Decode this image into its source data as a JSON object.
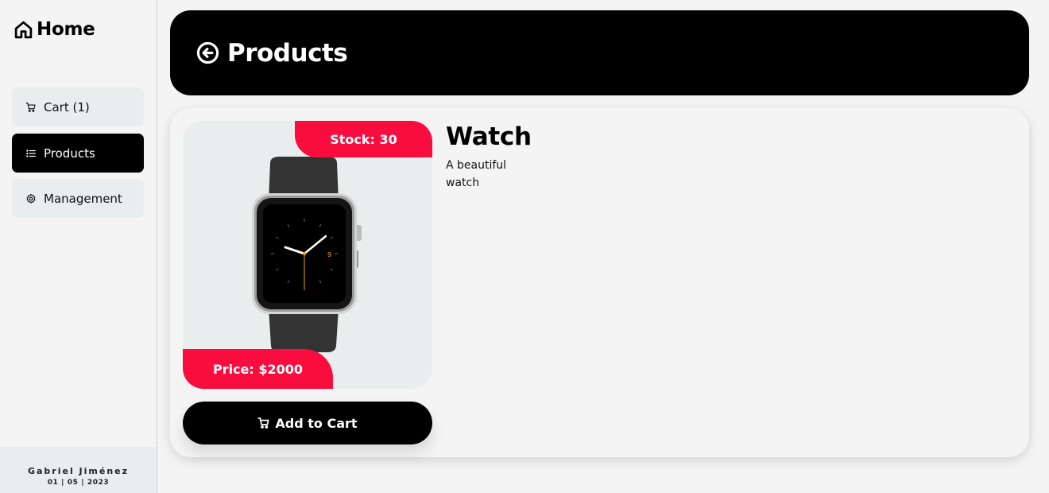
{
  "sidebar": {
    "brand": "Home",
    "items": [
      {
        "label": "Cart (1)",
        "icon": "cart-icon"
      },
      {
        "label": "Products",
        "icon": "list-icon",
        "active": true
      },
      {
        "label": "Management",
        "icon": "gear-icon"
      }
    ],
    "footer": {
      "name": "Gabriel Jiménez",
      "date": "01 | 05 | 2023"
    }
  },
  "header": {
    "title": "Products",
    "back_icon": "back-arrow-circle-icon"
  },
  "product": {
    "name": "Watch",
    "description": "A beautiful watch",
    "stock_label": "Stock: 30",
    "price_label": "Price: $2000",
    "add_button": "Add to Cart",
    "image": "smartwatch-image"
  },
  "colors": {
    "accent": "#f80d3e",
    "dark": "#000000",
    "surface": "#e9edee",
    "background": "#f4f4f4"
  }
}
